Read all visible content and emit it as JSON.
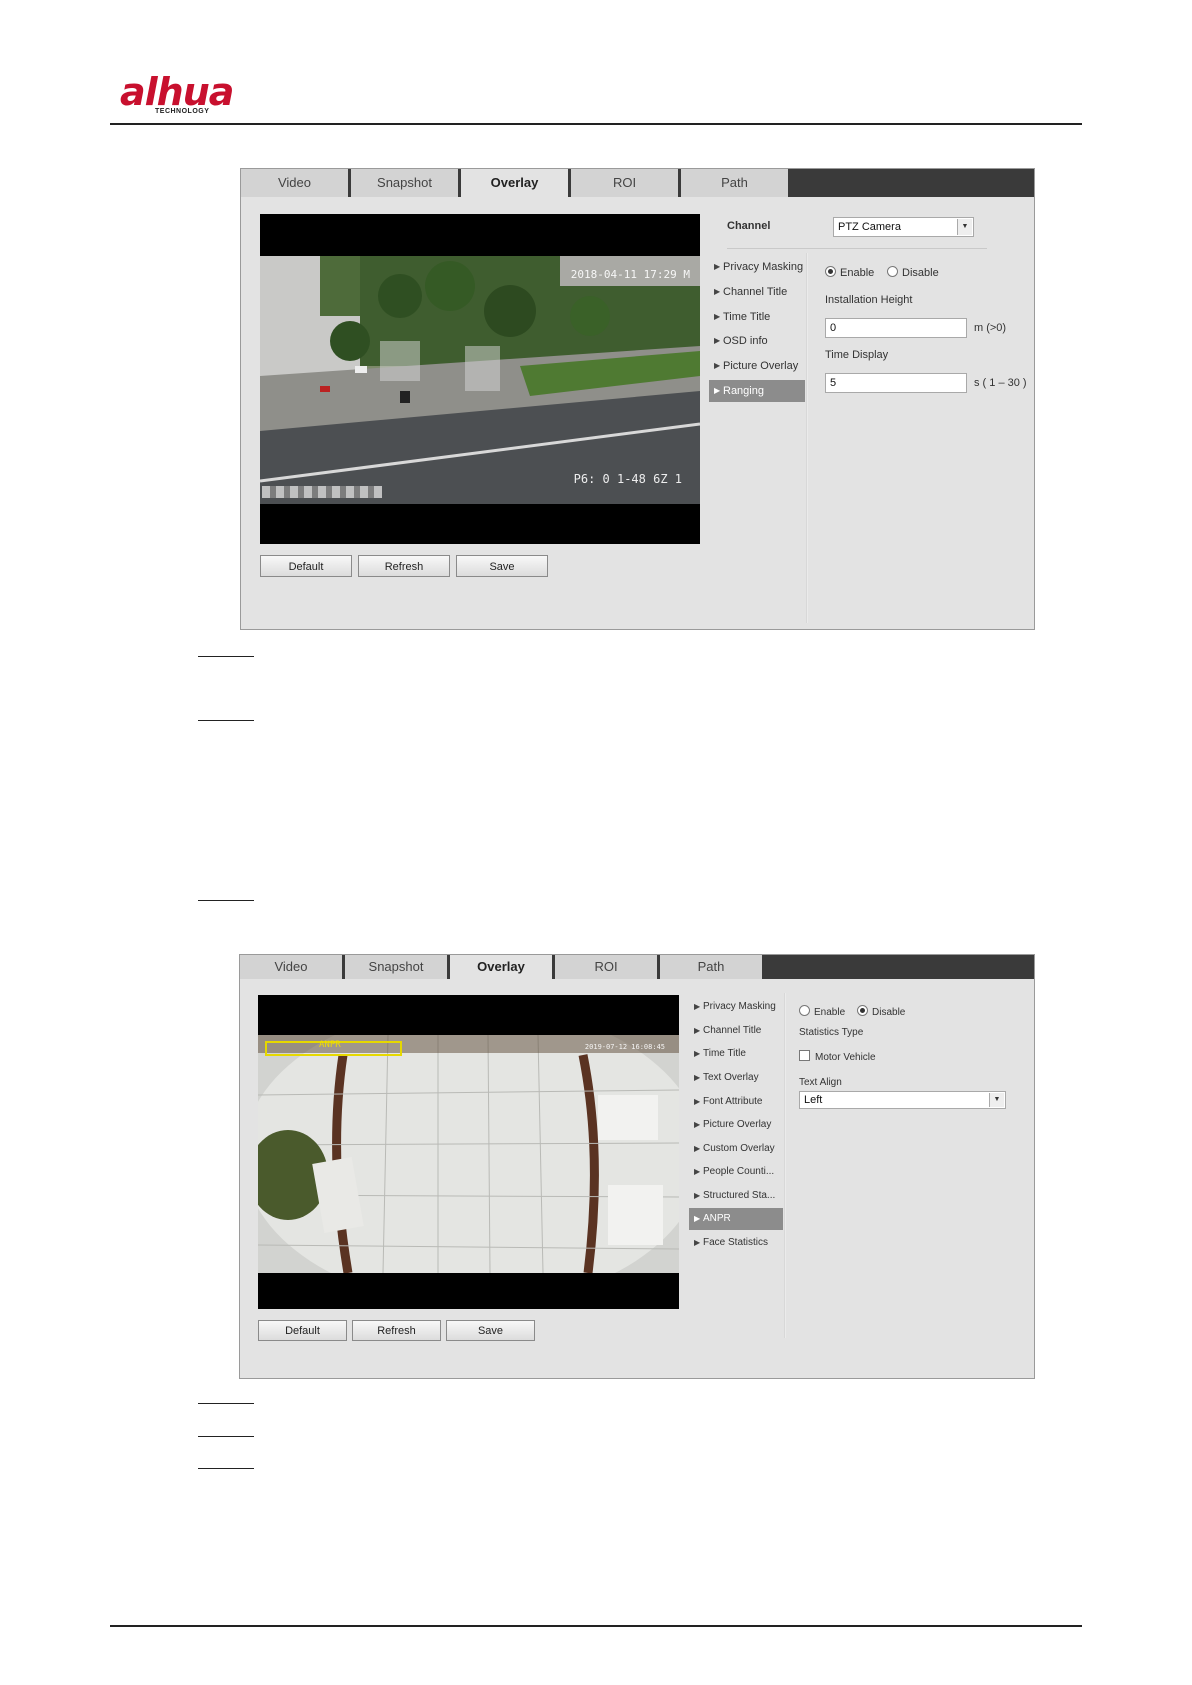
{
  "header": {
    "brand": "alhua",
    "brand_sub": "TECHNOLOGY",
    "brand_color": "#c8102e"
  },
  "panel1": {
    "tabs": [
      "Video",
      "Snapshot",
      "Overlay",
      "ROI",
      "Path"
    ],
    "active_tab": "Overlay",
    "channel_label": "Channel",
    "channel_value": "PTZ Camera",
    "menu": [
      "Privacy Masking",
      "Channel Title",
      "Time Title",
      "OSD info",
      "Picture Overlay",
      "Ranging"
    ],
    "active_menu": "Ranging",
    "enable_label": "Enable",
    "disable_label": "Disable",
    "enabled": true,
    "installation_height_label": "Installation Height",
    "installation_height_value": "0",
    "installation_height_unit": "m (>0)",
    "time_display_label": "Time Display",
    "time_display_value": "5",
    "time_display_unit": "s ( 1 – 30 )",
    "video_timestamp": "2018-04-11 17:29 M",
    "video_caption": "P6: 0 1-48 6Z 1",
    "buttons": [
      "Default",
      "Refresh",
      "Save"
    ]
  },
  "panel2": {
    "tabs": [
      "Video",
      "Snapshot",
      "Overlay",
      "ROI",
      "Path"
    ],
    "active_tab": "Overlay",
    "menu": [
      "Privacy Masking",
      "Channel Title",
      "Time Title",
      "Text Overlay",
      "Font Attribute",
      "Picture Overlay",
      "Custom Overlay",
      "People Counti...",
      "Structured Sta...",
      "ANPR",
      "Face Statistics"
    ],
    "active_menu": "ANPR",
    "enable_label": "Enable",
    "disable_label": "Disable",
    "enabled": false,
    "statistics_type_label": "Statistics Type",
    "motor_vehicle_label": "Motor Vehicle",
    "motor_vehicle_checked": false,
    "text_align_label": "Text Align",
    "text_align_value": "Left",
    "video_anpr_label": "ANPR",
    "video_timestamp": "2019-07-12 16:08:45",
    "buttons": [
      "Default",
      "Refresh",
      "Save"
    ]
  }
}
